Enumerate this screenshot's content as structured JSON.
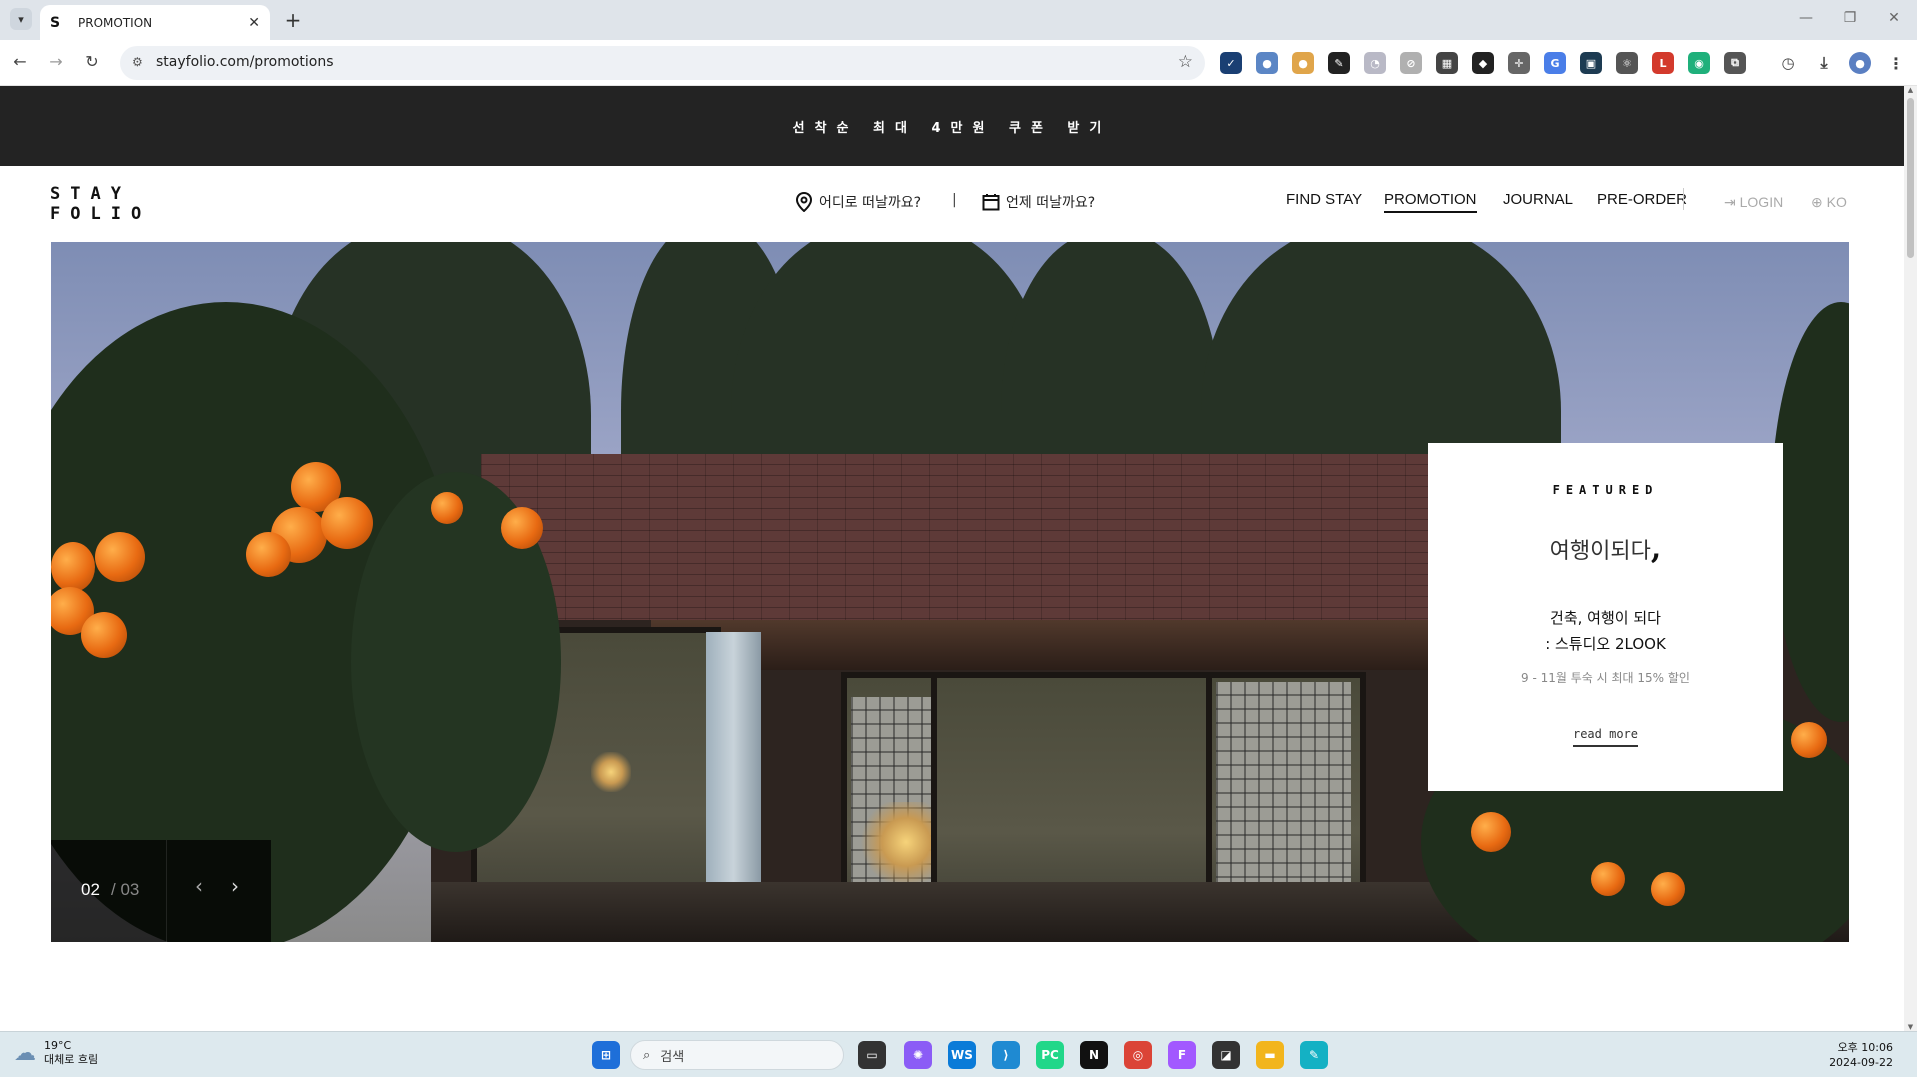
{
  "browser": {
    "tab_title": "PROMOTION",
    "tab_favicon": "S",
    "url": "stayfolio.com/promotions",
    "extensions": [
      {
        "name": "check-ext-icon",
        "color": "#1a3f73",
        "glyph": "✓"
      },
      {
        "name": "profile-ext-icon",
        "color": "#5b86c5",
        "glyph": "●"
      },
      {
        "name": "cookie-ext-icon",
        "color": "#e0a54a",
        "glyph": "●"
      },
      {
        "name": "eyedropper-ext-icon",
        "color": "#222222",
        "glyph": "✎"
      },
      {
        "name": "timer-ext-icon",
        "color": "#b9b9c6",
        "glyph": "◔"
      },
      {
        "name": "compass-ext-icon",
        "color": "#b0b0b0",
        "glyph": "⊘"
      },
      {
        "name": "layout-ext-icon",
        "color": "#444444",
        "glyph": "▦"
      },
      {
        "name": "puzzle-dark-ext-icon",
        "color": "#222222",
        "glyph": "◆"
      },
      {
        "name": "crosshair-ext-icon",
        "color": "#666666",
        "glyph": "✛"
      },
      {
        "name": "translate-ext-icon",
        "color": "#4a7ee8",
        "glyph": "G"
      },
      {
        "name": "grid-ext-icon",
        "color": "#1d3b52",
        "glyph": "▣"
      },
      {
        "name": "react-ext-icon",
        "color": "#555555",
        "glyph": "⚛"
      },
      {
        "name": "lit-ext-icon",
        "color": "#d33a2c",
        "glyph": "L"
      },
      {
        "name": "chat-ext-icon",
        "color": "#1fb07b",
        "glyph": "◉"
      },
      {
        "name": "extensions-icon",
        "color": "#555555",
        "glyph": "⧉"
      }
    ]
  },
  "banner": {
    "text": "선착순 최대 4만원 쿠폰 받기"
  },
  "header": {
    "logo": "STAY\nFOLIO",
    "where_label": "어디로 떠날까요?",
    "when_label": "언제 떠날까요?",
    "separator": "|",
    "nav": [
      "FIND STAY",
      "PROMOTION",
      "JOURNAL",
      "PRE-ORDER"
    ],
    "active_nav": "PROMOTION",
    "login": "LOGIN",
    "lang": "KO"
  },
  "hero": {
    "current": "02",
    "total": "/ 03",
    "card": {
      "label": "FEATURED",
      "brand_text": "여행이되다",
      "brand_mark": ",",
      "headline_line1": "건축, 여행이 되다",
      "headline_line2": ": 스튜디오 2LOOK",
      "sub": "9 - 11월 투숙 시 최대 15% 할인",
      "more": "read more"
    }
  },
  "taskbar": {
    "temp": "19°C",
    "weather": "대체로 흐림",
    "search_placeholder": "검색",
    "time": "오후 10:06",
    "date": "2024-09-22",
    "apps": [
      {
        "name": "windows-start-icon",
        "color": "#1e6fd9",
        "glyph": "⊞"
      },
      {
        "name": "task-view-icon",
        "color": "#333333",
        "glyph": "▭"
      },
      {
        "name": "copilot-icon",
        "color": "#8b5cf6",
        "glyph": "✺"
      },
      {
        "name": "webstorm-icon",
        "color": "#0a7bd8",
        "glyph": "WS"
      },
      {
        "name": "vscode-icon",
        "color": "#1f8ad2",
        "glyph": "⟩"
      },
      {
        "name": "pycharm-icon",
        "color": "#21d789",
        "glyph": "PC"
      },
      {
        "name": "notion-icon",
        "color": "#111111",
        "glyph": "N"
      },
      {
        "name": "chrome-icon",
        "color": "#db4437",
        "glyph": "◎"
      },
      {
        "name": "figma-icon",
        "color": "#a259ff",
        "glyph": "F"
      },
      {
        "name": "sticky-notes-icon",
        "color": "#333333",
        "glyph": "◪"
      },
      {
        "name": "file-explorer-icon",
        "color": "#f2b51c",
        "glyph": "▬"
      },
      {
        "name": "editor-app-icon",
        "color": "#14b1c4",
        "glyph": "✎"
      }
    ]
  }
}
